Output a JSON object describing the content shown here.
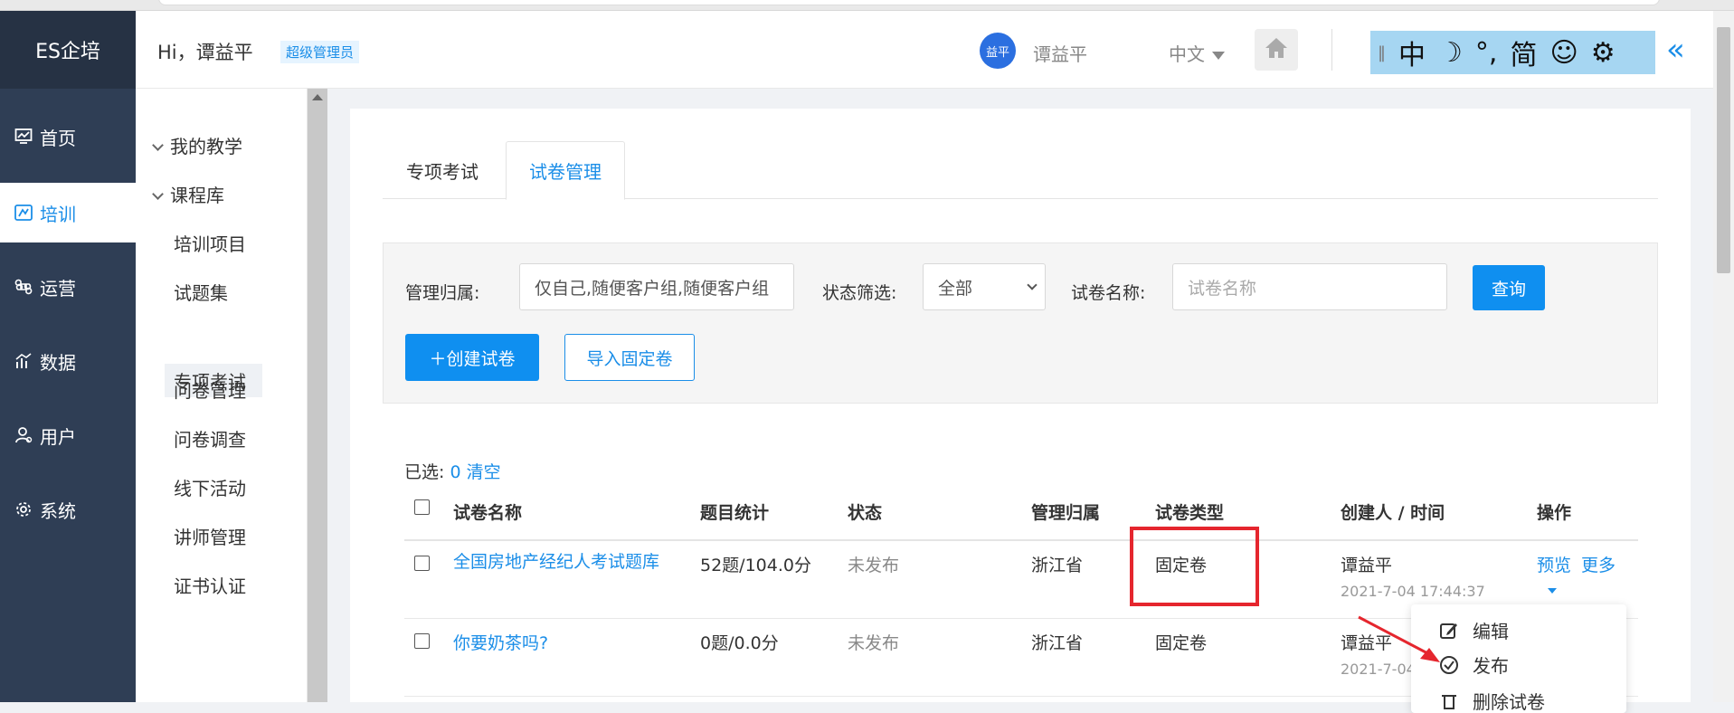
{
  "app": {
    "logo": "ES企培"
  },
  "header": {
    "greeting": "Hi，谭益平",
    "role": "超级管理员",
    "avatar_text": "益平",
    "user_name": "谭益平",
    "language": "中文"
  },
  "ime_toolbar": {
    "items": [
      "中",
      "☽",
      "°,",
      "简",
      "☺",
      "⚙"
    ]
  },
  "nav": {
    "items": [
      {
        "label": "首页",
        "icon": "dashboard-icon"
      },
      {
        "label": "培训",
        "icon": "training-icon",
        "active": true
      },
      {
        "label": "运营",
        "icon": "command-icon"
      },
      {
        "label": "数据",
        "icon": "chart-icon"
      },
      {
        "label": "用户",
        "icon": "user-icon"
      },
      {
        "label": "系统",
        "icon": "gear-icon"
      }
    ]
  },
  "submenu": {
    "groups": [
      "我的教学",
      "课程库"
    ],
    "items": [
      "培训项目",
      "试题集",
      "专项考试",
      "问卷管理",
      "问卷调查",
      "线下活动",
      "讲师管理",
      "证书认证"
    ],
    "active": "专项考试"
  },
  "tabs": [
    "专项考试",
    "试卷管理"
  ],
  "filter": {
    "owner_label": "管理归属:",
    "owner_value": "仅自己,随便客户组,随便客户组",
    "status_label": "状态筛选:",
    "status_value": "全部",
    "name_label": "试卷名称:",
    "name_placeholder": "试卷名称",
    "query_button": "查询",
    "create_button": "＋创建试卷",
    "import_button": "导入固定卷"
  },
  "selection": {
    "prefix": "已选:",
    "count": "0",
    "clear": "清空"
  },
  "table": {
    "headers": [
      "试卷名称",
      "题目统计",
      "状态",
      "管理归属",
      "试卷类型",
      "创建人 / 时间",
      "操作"
    ],
    "rows": [
      {
        "name": "全国房地产经纪人考试题库",
        "stats": "52题/104.0分",
        "status": "未发布",
        "owner": "浙江省",
        "type": "固定卷",
        "creator": "谭益平",
        "time": "2021-7-04 17:44:37",
        "preview": "预览",
        "more": "更多"
      },
      {
        "name": "你要奶茶吗?",
        "stats": "0题/0.0分",
        "status": "未发布",
        "owner": "浙江省",
        "type": "固定卷",
        "creator": "谭益平",
        "time": "2021-7-04"
      }
    ]
  },
  "more_menu": {
    "items": [
      "编辑",
      "发布",
      "删除试卷"
    ]
  },
  "colors": {
    "accent": "#1b8ee8",
    "nav_bg": "#2f3e55",
    "highlight": "#e5262e"
  }
}
